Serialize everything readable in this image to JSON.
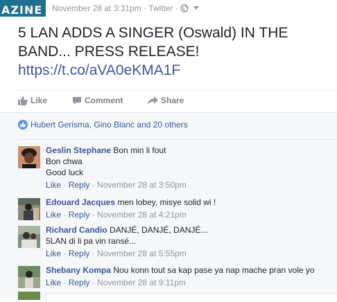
{
  "header": {
    "page_avatar_text": "AZINE",
    "timestamp": "November 28 at 3:31pm",
    "source": "Twitter",
    "audience_icon": "globe-icon",
    "menu_icon": "caret-down-icon"
  },
  "post": {
    "text": "5 LAN ADDS A SINGER (Oswald) IN THE BAND... PRESS RELEASE!",
    "link": "https://t.co/aVA0eKMA1F"
  },
  "actions": {
    "like": "Like",
    "comment": "Comment",
    "share": "Share"
  },
  "likes_summary": "Hubert Gerisma, Gino Blanc and 20 others",
  "comments": [
    {
      "author": "Geslin Stephane",
      "lines": [
        "Bon min li fout",
        "Bon chwa",
        "Good luck"
      ],
      "like": "Like",
      "reply": "Reply",
      "time": "November 28 at 3:50pm"
    },
    {
      "author": "Edouard Jacques",
      "lines": [
        "men lobey, misye solid wi !"
      ],
      "like": "Like",
      "reply": "Reply",
      "time": "November 28 at 4:21pm"
    },
    {
      "author": "Richard Candio",
      "lines": [
        "DANJÉ, DANJÉ, DANJÉ...",
        "5LAN di li pa vin ransé..."
      ],
      "like": "Like",
      "reply": "Reply",
      "time": "November 28 at 5:55pm"
    },
    {
      "author": "Shebany Kompa",
      "lines": [
        "Nou konn tout sa kap pase ya nap mache pran vole yo"
      ],
      "like": "Like",
      "reply": "Reply",
      "time": "November 28 at 9:11pm"
    }
  ],
  "colors": {
    "link": "#365899",
    "meta": "#90949c",
    "panel": "#f6f7f9",
    "like_badge": "#5890ff"
  }
}
